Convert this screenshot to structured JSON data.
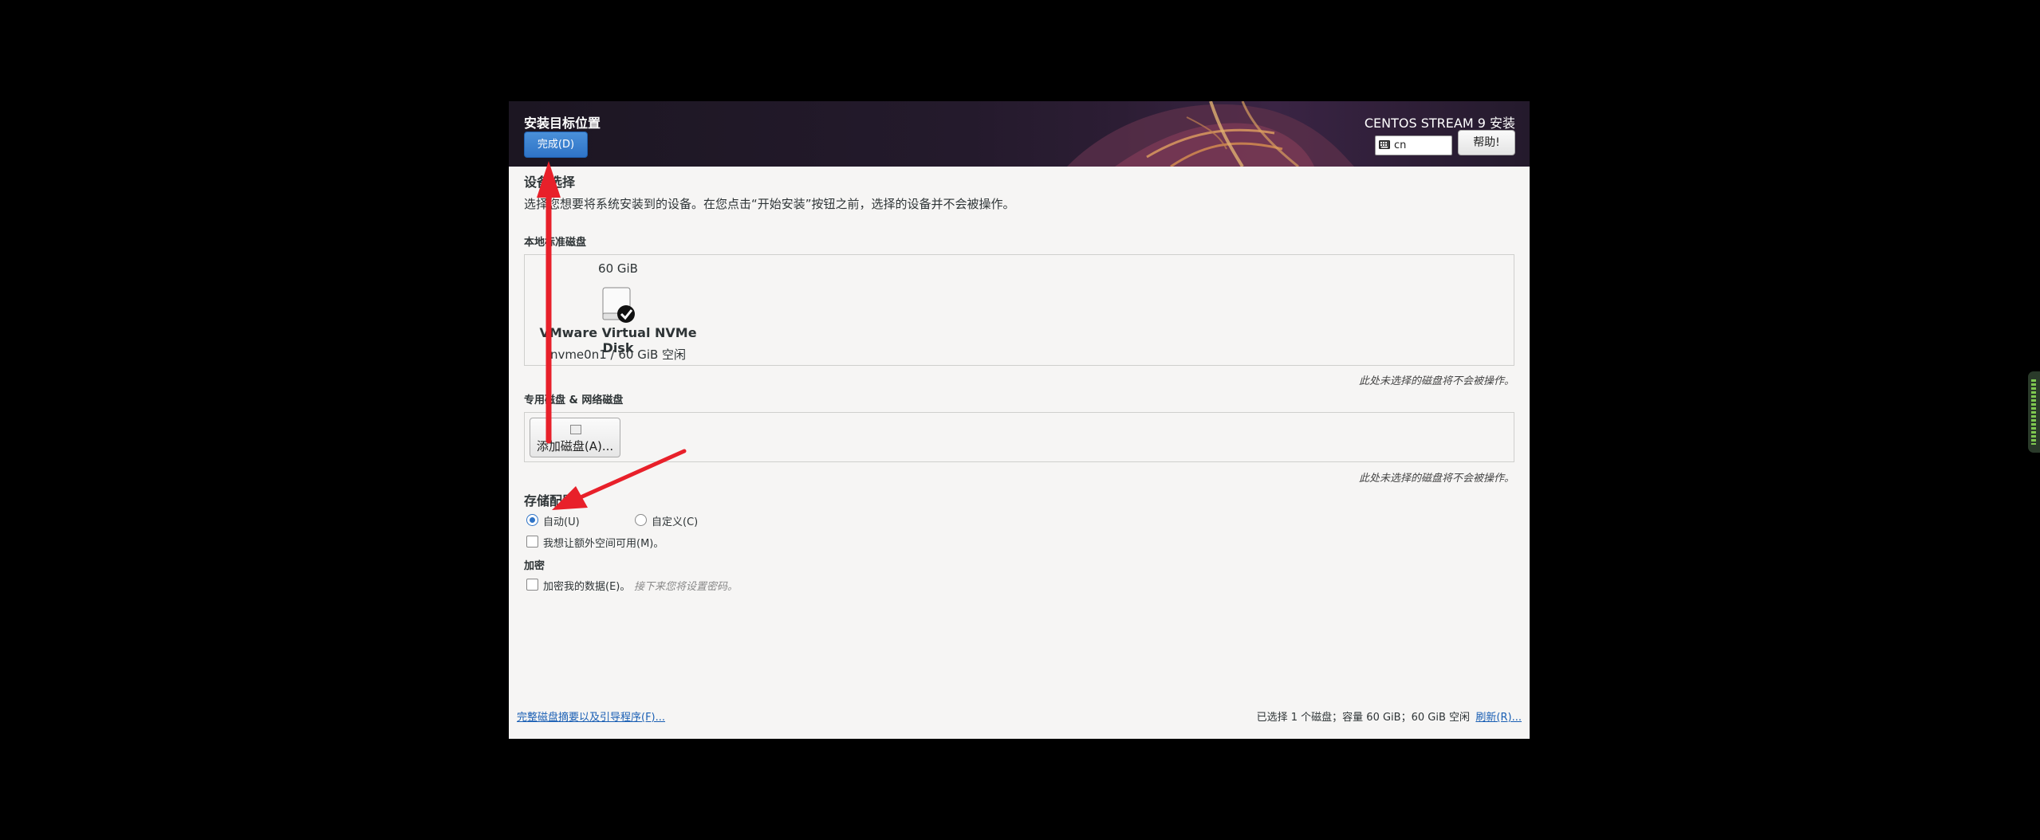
{
  "header": {
    "title": "安装目标位置",
    "done_label": "完成(D)",
    "product": "CENTOS STREAM 9 安装",
    "keyboard_layout": "cn",
    "help_label": "帮助!"
  },
  "device_selection": {
    "heading": "设备选择",
    "description": "选择您想要将系统安装到的设备。在您点击“开始安装”按钮之前，选择的设备并不会被操作。",
    "local_disks_label": "本地标准磁盘",
    "disk": {
      "size": "60 GiB",
      "name": "VMware Virtual NVMe Disk",
      "info": "nvme0n1  /  60 GiB 空闲",
      "selected": true
    },
    "local_note": "此处未选择的磁盘将不会被操作。",
    "special_disks_label": "专用磁盘 & 网络磁盘",
    "add_disk_label": "添加磁盘(A)...",
    "special_note": "此处未选择的磁盘将不会被操作。"
  },
  "storage_config": {
    "heading": "存储配置",
    "auto_label": "自动(U)",
    "custom_label": "自定义(C)",
    "selected": "auto",
    "extra_space_label": "我想让额外空间可用(M)。",
    "extra_space_checked": false
  },
  "encryption": {
    "heading": "加密",
    "encrypt_label": "加密我的数据(E)。",
    "encrypt_checked": false,
    "encrypt_hint": "接下来您将设置密码。"
  },
  "footer": {
    "summary_link": "完整磁盘摘要以及引导程序(F)...",
    "status": "已选择 1 个磁盘；容量 60 GiB；60 GiB 空闲",
    "refresh_link": "刷新(R)..."
  },
  "colors": {
    "accent": "#2f74c7",
    "annotation_arrow": "#e8202a",
    "window_bg": "#f6f5f4",
    "header_bg": "#241a2c"
  }
}
